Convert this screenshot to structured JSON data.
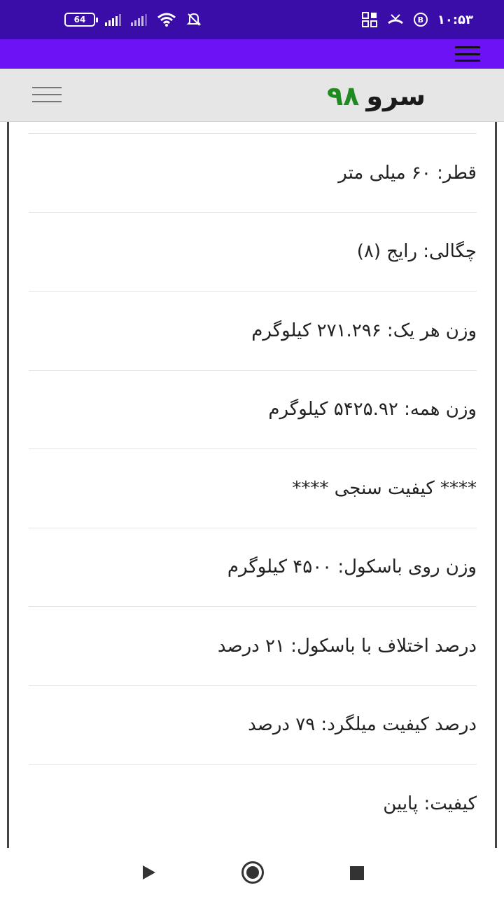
{
  "status_bar": {
    "battery": "64",
    "time": "۱۰:۵۳",
    "bluetooth_badge": "B"
  },
  "header": {
    "logo_word": "سرو",
    "logo_number": "۹۸"
  },
  "rows": [
    {
      "text": "قطر: ۶۰ میلی متر"
    },
    {
      "text": "چگالی: رایج (۸)"
    },
    {
      "text": "وزن هر یک: ۲۷۱.۲۹۶ کیلوگرم"
    },
    {
      "text": "وزن همه: ۵۴۲۵.۹۲ کیلوگرم"
    },
    {
      "text": "**** کیفیت سنجی ****"
    },
    {
      "text": "وزن روی باسکول: ۴۵۰۰ کیلوگرم"
    },
    {
      "text": "درصد اختلاف با باسکول: ۲۱ درصد"
    },
    {
      "text": "درصد کیفیت میلگرد: ۷۹ درصد"
    },
    {
      "text": "کیفیت: پایین"
    }
  ],
  "colors": {
    "status_bar": "#3A0CA8",
    "app_bar": "#6D12F5",
    "header_bg": "#E6E6E6",
    "logo_number": "#1F8A1F"
  }
}
